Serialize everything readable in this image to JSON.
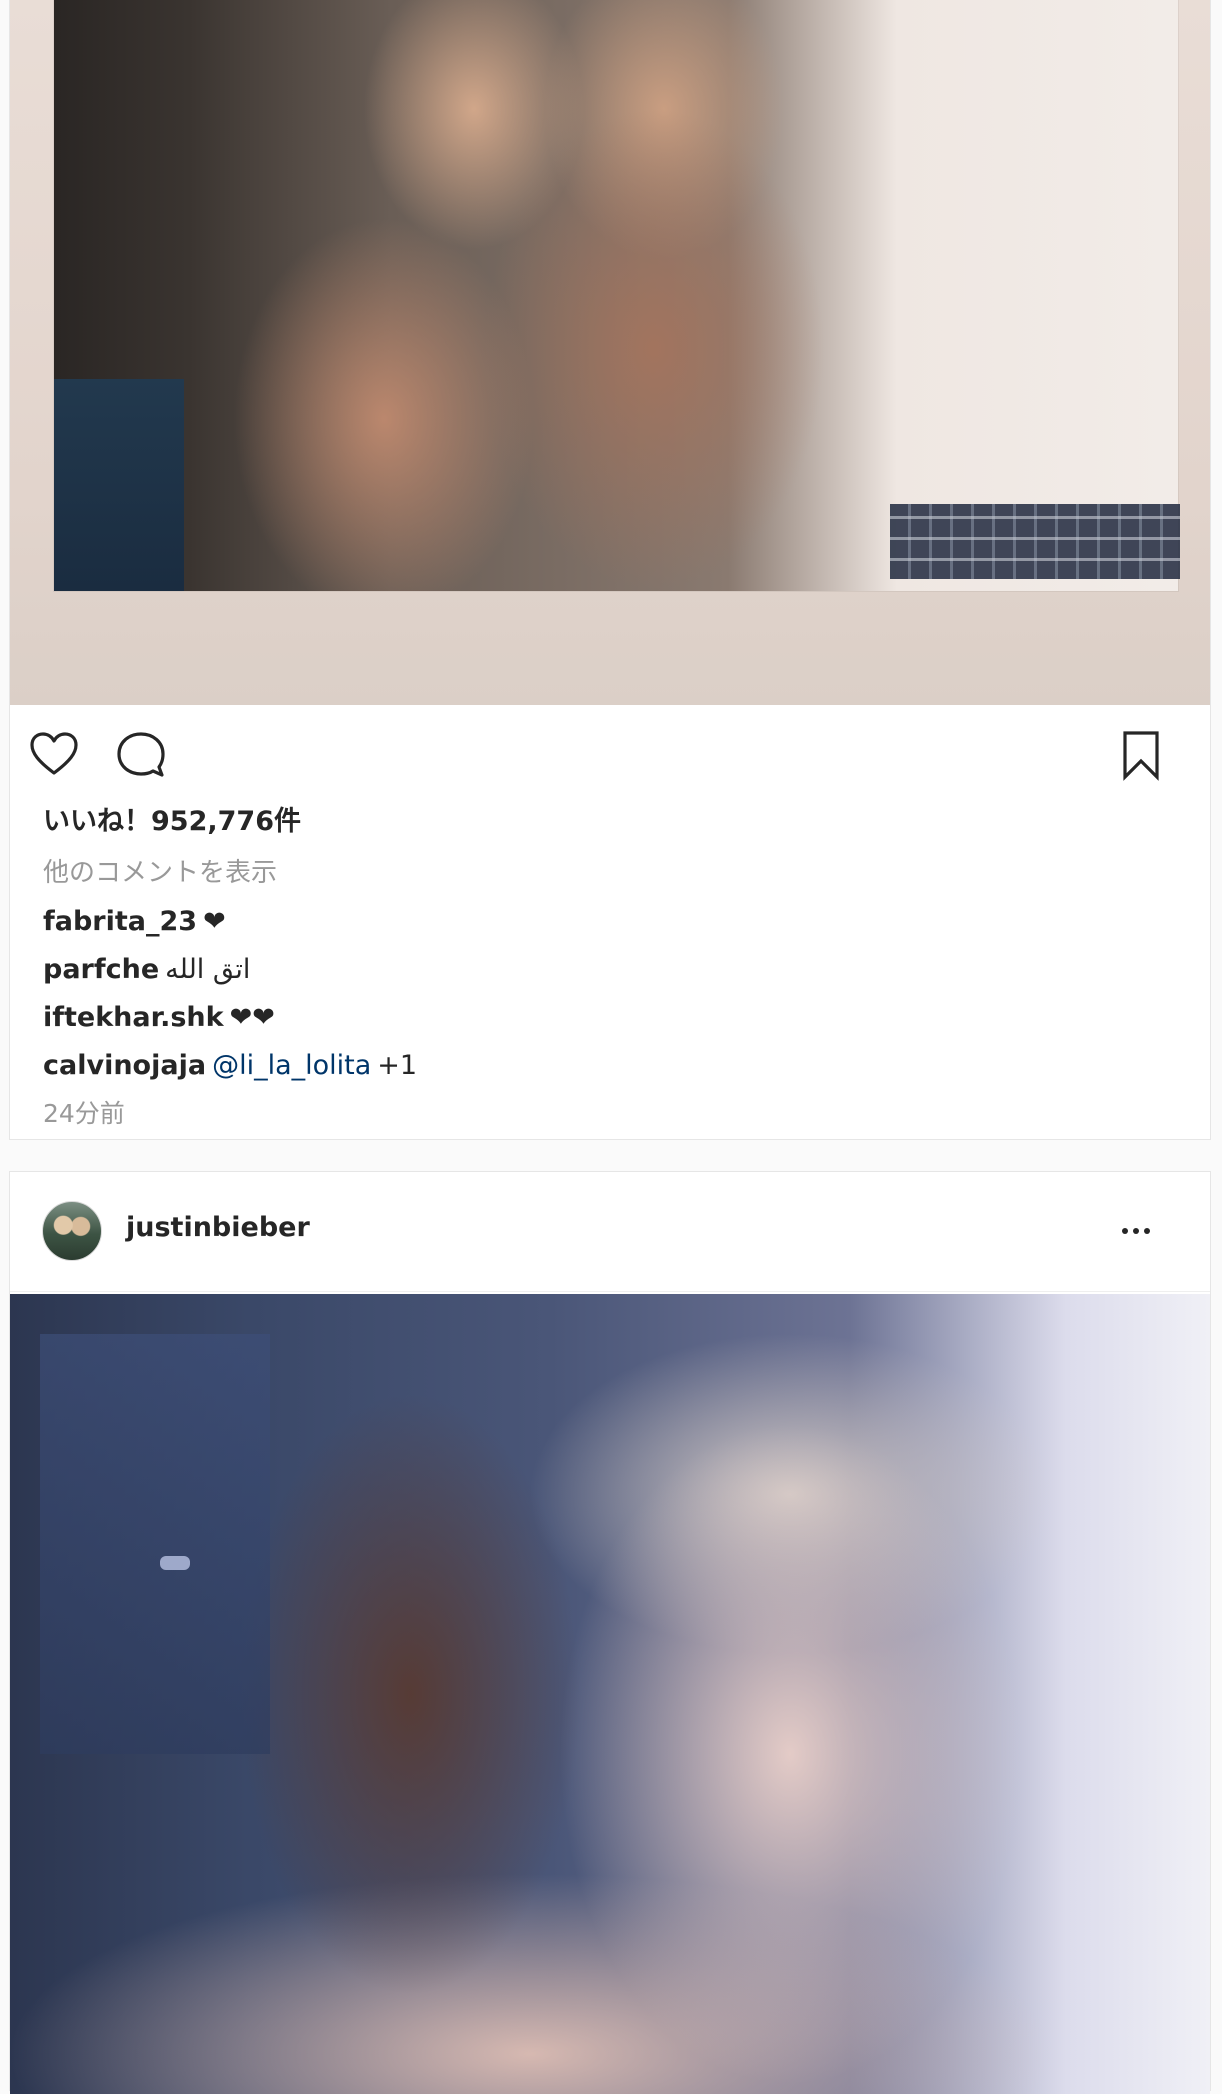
{
  "post1": {
    "likes": "いいね！952,776件",
    "view_more_comments": "他のコメントを表示",
    "comments": [
      {
        "user": "fabrita_23",
        "text": "❤"
      },
      {
        "user": "parfche",
        "text": "اتق الله"
      },
      {
        "user": "iftekhar.shk",
        "text": "❤❤"
      },
      {
        "user": "calvinojaja",
        "mention": "@li_la_lolita",
        "suffix": "+1"
      }
    ],
    "timestamp": "24分前",
    "icons": {
      "like": "heart-icon",
      "comment": "comment-icon",
      "save": "bookmark-icon"
    }
  },
  "post2": {
    "username": "justinbieber",
    "more_icon": "more-options-icon"
  },
  "colors": {
    "text": "#262626",
    "secondary": "#999999",
    "mention": "#003569",
    "background": "#fafafa",
    "card": "#ffffff",
    "border": "#e6e6e6"
  }
}
